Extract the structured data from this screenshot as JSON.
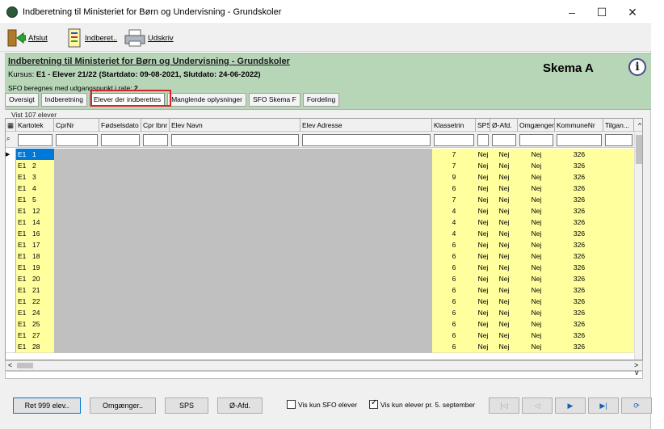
{
  "window": {
    "title": "Indberetning til Ministeriet for Børn og Undervisning - Grundskoler",
    "controls": [
      "–",
      "☐",
      "✕"
    ]
  },
  "toolbar": {
    "afslut": "Afslut",
    "indberet": "Indberet..",
    "udskriv": "Udskriv"
  },
  "banner": {
    "title": "Indberetning til Ministeriet for Børn og Undervisning - Grundskoler",
    "kursus_label": "Kursus:",
    "kursus_value": "E1 - Elever 21/22 (Startdato: 09-08-2021, Slutdato: 24-06-2022)",
    "sfo_label": "SFO beregnes med udgangspunkt i rate:",
    "sfo_value": "2",
    "skema": "Skema A"
  },
  "tabs": [
    "Oversigt",
    "Indberetning",
    "Elever der indberettes",
    "Manglende oplysninger",
    "SFO Skema F",
    "Fordeling"
  ],
  "count_label": "Vist 107 elever",
  "grid": {
    "columns": [
      "Kartotek",
      "CprNr",
      "Fødselsdato",
      "Cpr lbnr",
      "Elev Navn",
      "Elev Adresse",
      "Klassetrin",
      "SPS",
      "Ø-Afd.",
      "Omgænger",
      "KommuneNr",
      "Tilgan..."
    ],
    "rows": [
      {
        "kartotek": "E1",
        "nr": "1",
        "klassetrin": "7",
        "sps": "Nej",
        "oafd": "Nej",
        "omg": "Nej",
        "kommune": "326"
      },
      {
        "kartotek": "E1",
        "nr": "2",
        "klassetrin": "7",
        "sps": "Nej",
        "oafd": "Nej",
        "omg": "Nej",
        "kommune": "326"
      },
      {
        "kartotek": "E1",
        "nr": "3",
        "klassetrin": "9",
        "sps": "Nej",
        "oafd": "Nej",
        "omg": "Nej",
        "kommune": "326"
      },
      {
        "kartotek": "E1",
        "nr": "4",
        "klassetrin": "6",
        "sps": "Nej",
        "oafd": "Nej",
        "omg": "Nej",
        "kommune": "326"
      },
      {
        "kartotek": "E1",
        "nr": "5",
        "klassetrin": "7",
        "sps": "Nej",
        "oafd": "Nej",
        "omg": "Nej",
        "kommune": "326"
      },
      {
        "kartotek": "E1",
        "nr": "12",
        "klassetrin": "4",
        "sps": "Nej",
        "oafd": "Nej",
        "omg": "Nej",
        "kommune": "326"
      },
      {
        "kartotek": "E1",
        "nr": "14",
        "klassetrin": "4",
        "sps": "Nej",
        "oafd": "Nej",
        "omg": "Nej",
        "kommune": "326"
      },
      {
        "kartotek": "E1",
        "nr": "16",
        "klassetrin": "4",
        "sps": "Nej",
        "oafd": "Nej",
        "omg": "Nej",
        "kommune": "326"
      },
      {
        "kartotek": "E1",
        "nr": "17",
        "klassetrin": "6",
        "sps": "Nej",
        "oafd": "Nej",
        "omg": "Nej",
        "kommune": "326"
      },
      {
        "kartotek": "E1",
        "nr": "18",
        "klassetrin": "6",
        "sps": "Nej",
        "oafd": "Nej",
        "omg": "Nej",
        "kommune": "326"
      },
      {
        "kartotek": "E1",
        "nr": "19",
        "klassetrin": "6",
        "sps": "Nej",
        "oafd": "Nej",
        "omg": "Nej",
        "kommune": "326"
      },
      {
        "kartotek": "E1",
        "nr": "20",
        "klassetrin": "6",
        "sps": "Nej",
        "oafd": "Nej",
        "omg": "Nej",
        "kommune": "326"
      },
      {
        "kartotek": "E1",
        "nr": "21",
        "klassetrin": "6",
        "sps": "Nej",
        "oafd": "Nej",
        "omg": "Nej",
        "kommune": "326"
      },
      {
        "kartotek": "E1",
        "nr": "22",
        "klassetrin": "6",
        "sps": "Nej",
        "oafd": "Nej",
        "omg": "Nej",
        "kommune": "326"
      },
      {
        "kartotek": "E1",
        "nr": "24",
        "klassetrin": "6",
        "sps": "Nej",
        "oafd": "Nej",
        "omg": "Nej",
        "kommune": "326"
      },
      {
        "kartotek": "E1",
        "nr": "25",
        "klassetrin": "6",
        "sps": "Nej",
        "oafd": "Nej",
        "omg": "Nej",
        "kommune": "326"
      },
      {
        "kartotek": "E1",
        "nr": "27",
        "klassetrin": "6",
        "sps": "Nej",
        "oafd": "Nej",
        "omg": "Nej",
        "kommune": "326"
      },
      {
        "kartotek": "E1",
        "nr": "28",
        "klassetrin": "6",
        "sps": "Nej",
        "oafd": "Nej",
        "omg": "Nej",
        "kommune": "326"
      }
    ]
  },
  "bottom": {
    "ret": "Ret 999 elev..",
    "omgaenger": "Omgænger..",
    "sps": "SPS",
    "oafd": "Ø-Afd.",
    "vis_sfo": "Vis kun SFO elever",
    "vis_sept": "Vis kun elever pr. 5. september"
  },
  "colors": {
    "row_yellow": "#ffff9e",
    "banner_green": "#b7d6b8",
    "highlight_red": "#d7262b",
    "selection": "#0078d7"
  }
}
